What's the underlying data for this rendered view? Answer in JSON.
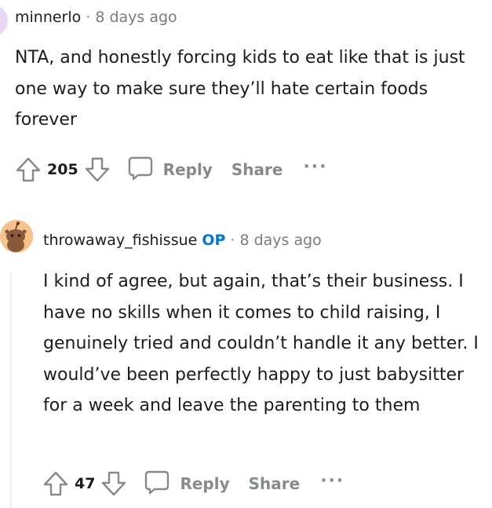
{
  "comments": [
    {
      "username": "minnerlo",
      "op_badge": "",
      "separator": "·",
      "time": "8 days ago",
      "text": "NTA, and honestly forcing kids to eat like that is just one way to make sure they’ll hate certain foods forever",
      "score": "205",
      "reply_label": "Reply",
      "share_label": "Share",
      "more_label": "···"
    },
    {
      "username": "throwaway_fishissue",
      "op_badge": "OP",
      "separator": "·",
      "time": "8 days ago",
      "text": "I kind of agree, but again, that’s their business. I have no skills when it comes to child raising, I genuinely tried and couldn’t handle it any better. I would’ve been perfectly happy to just babysitter for a week and leave the parenting to them",
      "score": "47",
      "reply_label": "Reply",
      "share_label": "Share",
      "more_label": "···"
    }
  ],
  "colors": {
    "op": "#0079d3",
    "muted": "#878a8c",
    "text": "#1c1c1c",
    "avatar_bg": "#f6c38e"
  },
  "icons": {
    "upvote": "arrow-up-outline-icon",
    "downvote": "arrow-down-outline-icon",
    "reply": "speech-bubble-icon",
    "more": "ellipsis-icon",
    "avatar": "snoo-avatar-icon"
  }
}
